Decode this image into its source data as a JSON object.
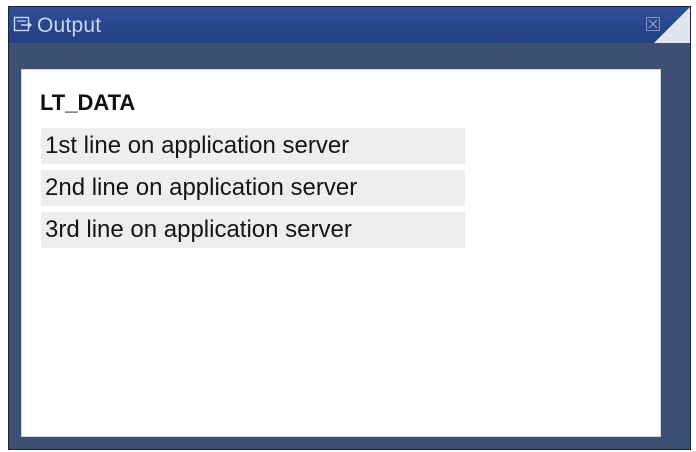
{
  "window": {
    "title": "Output",
    "icons": {
      "title_icon": "output-window-icon",
      "close_icon": "close-icon"
    },
    "colors": {
      "titlebar": "#2f4e99",
      "frame": "#3d4f72",
      "content_bg": "#ffffff",
      "row_bg": "#eeeeee"
    }
  },
  "output": {
    "heading": "LT_DATA",
    "lines": [
      "1st line on application server",
      "2nd line on application server",
      "3rd line on application server"
    ]
  }
}
